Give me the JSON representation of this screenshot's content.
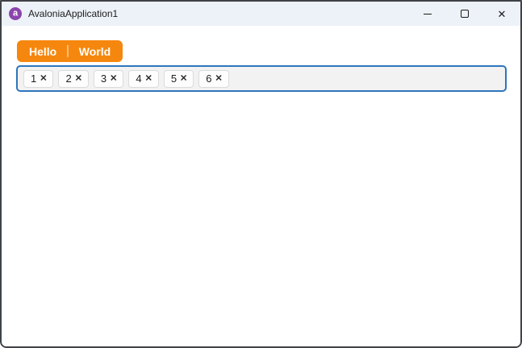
{
  "window": {
    "title": "AvaloniaApplication1"
  },
  "titlebar": {
    "controls": [
      "minimize",
      "maximize",
      "close"
    ]
  },
  "icons": {
    "app_logo": "a",
    "close": "✕",
    "chip_remove": "✕"
  },
  "tabs": {
    "items": [
      {
        "label": "Hello"
      },
      {
        "label": "World"
      }
    ]
  },
  "tags_input": {
    "chips": [
      {
        "label": "1"
      },
      {
        "label": "2"
      },
      {
        "label": "3"
      },
      {
        "label": "4"
      },
      {
        "label": "5"
      },
      {
        "label": "6"
      }
    ]
  },
  "colors": {
    "accent_orange": "#F6870E",
    "focus_border_blue": "#2E75BC",
    "titlebar_bg": "#EDF2F8",
    "logo_purple": "#8B44AC",
    "window_border": "#3F4347",
    "chip_bg": "#FDFDFD",
    "tags_bg": "#F2F2F2"
  }
}
